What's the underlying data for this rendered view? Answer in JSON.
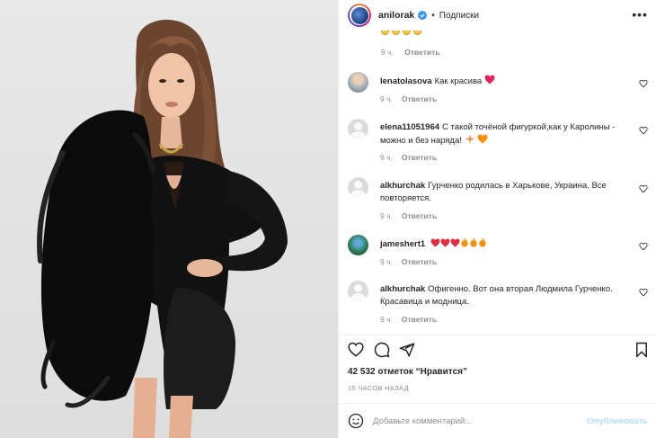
{
  "header": {
    "username": "anilorak",
    "separator": "•",
    "follow_label": "Подписки",
    "more_icon": "more-horizontal-icon"
  },
  "top_comment": {
    "time": "9 ч.",
    "reply": "Ответить"
  },
  "comments": [
    {
      "user": "lenatolasova",
      "text": "Как красива",
      "emoji": "red-heart",
      "time": "9 ч.",
      "reply": "Ответить",
      "avatar": "photo"
    },
    {
      "user": "elena11051964",
      "text": "С такой точёной фигуркой,как у Каролины - можно и без наряда!",
      "emoji": "sparkle-orange-heart",
      "time": "9 ч.",
      "reply": "Ответить",
      "avatar": "default"
    },
    {
      "user": "alkhurchak",
      "text": "Гурченко родилась в Харькове, Украина. Все повторяется.",
      "emoji": "",
      "time": "9 ч.",
      "reply": "Ответить",
      "avatar": "default"
    },
    {
      "user": "jameshert1",
      "text": "",
      "emoji": "hearts-and-fire",
      "time": "9 ч.",
      "reply": "Ответить",
      "avatar": "photo"
    },
    {
      "user": "alkhurchak",
      "text": "Офигенно. Вот она вторая Людмила Гурченко. Красавица и модница.",
      "emoji": "",
      "time": "9 ч.",
      "reply": "Ответить",
      "avatar": "default"
    }
  ],
  "actions": {
    "like_icon": "heart-icon",
    "comment_icon": "comment-icon",
    "share_icon": "send-icon",
    "save_icon": "bookmark-icon"
  },
  "likes": {
    "count": "42 532",
    "label": "отметок",
    "quote": "“Нравится”"
  },
  "posted_time": "15 ЧАСОВ НАЗАД",
  "add_comment": {
    "placeholder": "Добавьте комментарий...",
    "publish": "Опубликовать",
    "emoji_icon": "smile-icon"
  },
  "colors": {
    "accent_blue": "#0095f6",
    "publish_disabled": "#b2dffc",
    "muted": "#8e8e8e",
    "text": "#262626",
    "heart_red": "#ed4956"
  }
}
